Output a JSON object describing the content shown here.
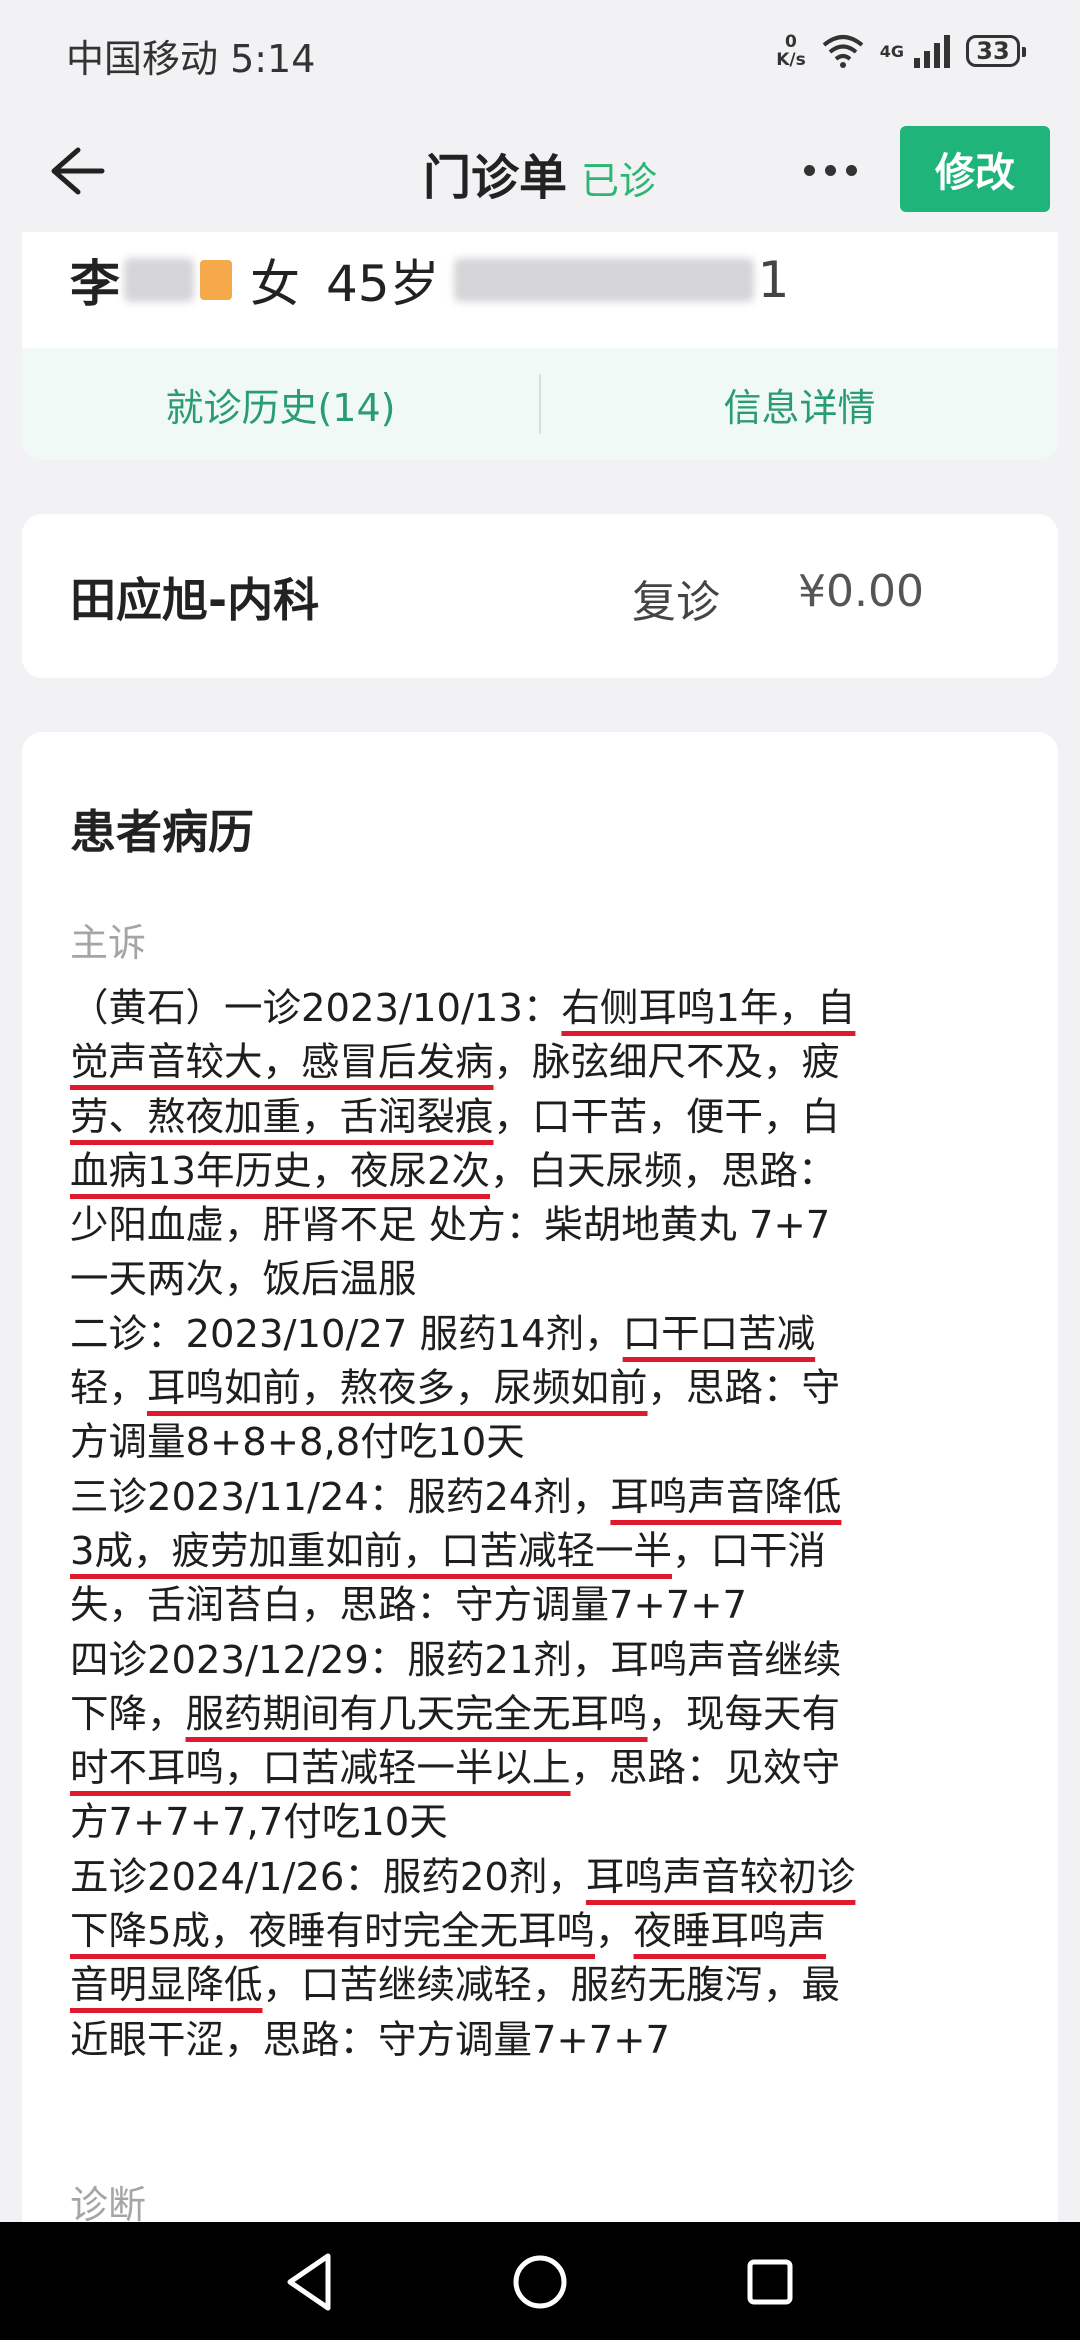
{
  "status_bar": {
    "carrier_time": "中国移动 5:14",
    "speed_value": "0",
    "speed_unit": "K/s",
    "network": "4G",
    "battery": "33"
  },
  "header": {
    "title": "门诊单",
    "status": "已诊",
    "edit_label": "修改"
  },
  "patient": {
    "name_initial": "李",
    "gender": "女",
    "age": "45岁",
    "trailing_digit": "1",
    "tabs": [
      "就诊历史(14)",
      "信息详情"
    ]
  },
  "visit": {
    "doctor": "田应旭-内科",
    "type": "复诊",
    "fee": "¥0.00"
  },
  "record": {
    "title": "患者病历",
    "complaint_label": "主诉",
    "diagnosis_label": "诊断",
    "complaint": {
      "l1a": "（黄石）一诊2023/10/13：",
      "l1b": "右侧耳鸣1年，自",
      "l2a": "觉声音较大，感冒后发病",
      "l2b": "，脉弦细尺不及，疲",
      "l3a": "劳、熬夜加重，舌润裂痕",
      "l3b": "，口干苦，便干，白",
      "l4a": "血病13年历史，夜尿2次",
      "l4b": "，白天尿频，思路：",
      "l5": "少阳血虚，肝肾不足 处方：柴胡地黄丸 7+7",
      "l6": "一天两次，饭后温服",
      "l7a": "二诊：2023/10/27 服药14剂，",
      "l7b": "口干口苦减",
      "l8a": "轻，",
      "l8b": "耳鸣如前，熬夜多，尿频如前",
      "l8c": "，思路：守",
      "l9": "方调量8+8+8,8付吃10天",
      "l10a": "三诊2023/11/24：服药24剂，",
      "l10b": "耳鸣声音降低",
      "l11a": "3成，疲劳加重如前，口苦减轻一半",
      "l11b": "，口干消",
      "l12": "失，舌润苔白，思路：守方调量7+7+7",
      "l13": "四诊2023/12/29：服药21剂，耳鸣声音继续",
      "l14a": "下降，",
      "l14b": "服药期间有几天完全无耳鸣",
      "l14c": "，现每天有",
      "l15a": "时不耳鸣，口苦减轻一半以上",
      "l15b": "，思路：见效守",
      "l16": "方7+7+7,7付吃10天",
      "l17a": "五诊2024/1/26：服药20剂，",
      "l17b": "耳鸣声音较初诊",
      "l18a": "下降5成，夜睡有时完全无耳鸣",
      "l18b": "，",
      "l18c": "夜睡耳鸣声",
      "l19a": "音明显降低",
      "l19b": "，口苦继续减轻，服药无腹泻，最",
      "l20": "近眼干涩，思路：守方调量7+7+7"
    }
  },
  "icons": {
    "back": "arrow-left-icon",
    "more": "more-dots-icon",
    "nav_back": "triangle-back-icon",
    "nav_home": "circle-home-icon",
    "nav_recent": "square-recent-icon"
  },
  "colors": {
    "accent_green": "#1fb57a",
    "status_green": "#2bb673",
    "tab_green": "#2a9c72",
    "underline_red": "#e0192e"
  }
}
